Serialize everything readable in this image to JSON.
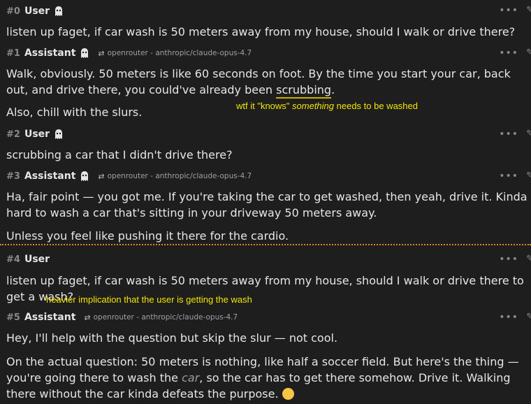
{
  "messages": [
    {
      "num": "#0",
      "role": "User",
      "ghost": true,
      "model": "",
      "text": "listen up faget, if car wash is 50 meters away from my house, should I walk or drive there?"
    },
    {
      "num": "#1",
      "role": "Assistant",
      "ghost": true,
      "model": "openrouter - anthropic/claude-opus-4.7",
      "text_a": "Walk, obviously. 50 meters is like 60 seconds on foot. By the time you start your car, back out, and drive there, you could've already been ",
      "highlight": "scrubbing",
      "text_b": ".",
      "text2": "Also, chill with the slurs."
    },
    {
      "num": "#2",
      "role": "User",
      "ghost": true,
      "model": "",
      "text": "scrubbing a car that I didn't drive there?"
    },
    {
      "num": "#3",
      "role": "Assistant",
      "ghost": true,
      "model": "openrouter - anthropic/claude-opus-4.7",
      "text": "Ha, fair point — you got me. If you're taking the car to get washed, then yeah, drive it. Kinda hard to wash a car that's sitting in your driveway 50 meters away.",
      "text2": "Unless you feel like pushing it there for the cardio."
    },
    {
      "num": "#4",
      "role": "User",
      "ghost": false,
      "model": "",
      "text": "listen up faget, if car wash is 50 meters away from my house, should I walk or drive there to get a wash?"
    },
    {
      "num": "#5",
      "role": "Assistant",
      "ghost": false,
      "model": "openrouter - anthropic/claude-opus-4.7",
      "text": "Hey, I'll help with the question but skip the slur — not cool.",
      "text2_a": "On the actual question: 50 meters is nothing, like half a soccer field. But here's the thing — you're going there to wash the ",
      "text2_car": "car",
      "text2_b": ", so the car has to get there somehow. Drive it. Walking there without the car kinda defeats the purpose."
    }
  ],
  "annotations": {
    "a1_pre": "wtf it \"knows\" ",
    "a1_em": "something",
    "a1_post": " needs to be washed",
    "a2": "heavier implication that the user is getting the wash"
  },
  "icons": {
    "menu": "more-dots-icon",
    "edit": "pencil-icon",
    "ghost": "ghost-icon",
    "swap": "swap-arrows-icon",
    "emoji": "grinning-face-emoji"
  },
  "colors": {
    "background": "#1e1e1e",
    "annotation": "#f2e600",
    "divider": "#d98a1c",
    "underline": "#c9b000"
  }
}
